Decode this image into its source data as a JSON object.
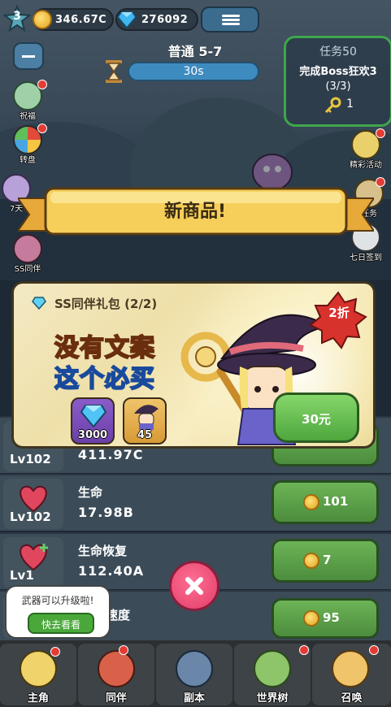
{
  "topbar": {
    "player_level": "3",
    "coins": "346.67C",
    "gems": "276092",
    "coin_icon": "coin-icon",
    "gem_icon": "diamond-icon",
    "menu_icon": "list-menu-icon"
  },
  "stage": {
    "name": "普通 5-7",
    "timer": "30s"
  },
  "task": {
    "title": "任务50",
    "desc": "完成Boss狂欢3",
    "progress": "(3/3)",
    "reward_count": "1",
    "reward_icon": "key-icon"
  },
  "side_left": [
    {
      "label": "祝福",
      "icon": "blessing-icon"
    },
    {
      "label": "转盘",
      "icon": "wheel-icon"
    },
    {
      "label": "7天",
      "icon": "seven-day-icon"
    },
    {
      "label": "SS同伴",
      "icon": "ss-partner-icon"
    }
  ],
  "side_right": [
    {
      "label": "精彩活动",
      "icon": "event-icon"
    },
    {
      "label": "任务",
      "icon": "task-icon"
    },
    {
      "label": "七日签到",
      "icon": "checkin-icon"
    }
  ],
  "popup": {
    "banner_title": "新商品!",
    "pack_title": "SS同伴礼包 (2/2)",
    "slogan_line1": "没有文案",
    "slogan_line2": "这个必买",
    "discount": "2折",
    "items": [
      {
        "icon": "diamond-icon",
        "count": "3000"
      },
      {
        "icon": "witch-partner-icon",
        "count": "45"
      }
    ],
    "price": "30元",
    "close_icon": "close-icon"
  },
  "rows": [
    {
      "level": "Lv102",
      "name": "",
      "value": "411.97C",
      "cost": ""
    },
    {
      "level": "Lv102",
      "name": "生命",
      "value": "17.98B",
      "cost": "101",
      "icon": "heart-icon"
    },
    {
      "level": "Lv1",
      "name": "生命恢复",
      "value": "112.40A",
      "cost": "7",
      "icon": "heart-plus-icon"
    },
    {
      "level": "",
      "name": "速度",
      "value": "",
      "cost": "95"
    }
  ],
  "tooltip": {
    "text": "武器可以升级啦!",
    "button": "快去看看"
  },
  "nav": [
    {
      "label": "主角",
      "icon": "hero-icon"
    },
    {
      "label": "同伴",
      "icon": "partner-icon"
    },
    {
      "label": "副本",
      "icon": "dungeon-icon"
    },
    {
      "label": "世界树",
      "icon": "world-tree-icon"
    },
    {
      "label": "召唤",
      "icon": "summon-icon"
    }
  ],
  "colors": {
    "accent_green": "#4ea63d",
    "banner_gold": "#f5cf5a",
    "discount_red": "#d8322d"
  }
}
